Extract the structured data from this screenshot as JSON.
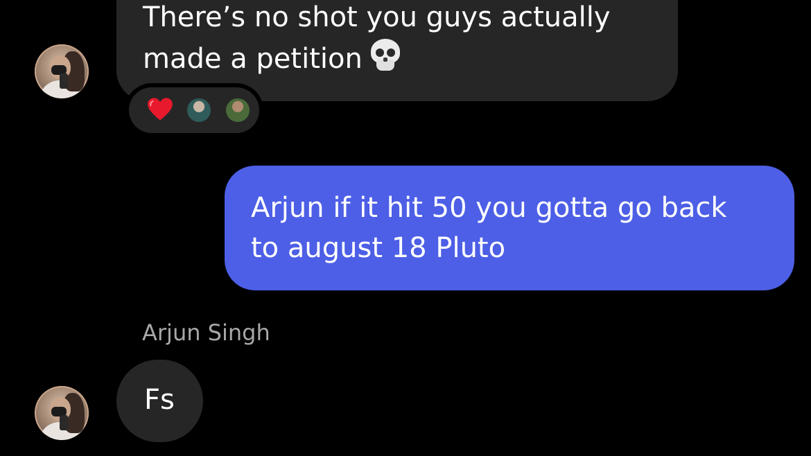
{
  "messages": [
    {
      "direction": "incoming",
      "lines": [
        "There’s no shot you guys actually",
        "made a petition"
      ],
      "emoji": "skull-icon",
      "reactions": {
        "emoji": "heart-icon",
        "reactors": [
          "reactor-avatar-1",
          "reactor-avatar-2"
        ]
      }
    },
    {
      "direction": "outgoing",
      "lines": [
        "Arjun if it hit 50 you gotta go back",
        "to august 18 Pluto"
      ]
    },
    {
      "direction": "incoming",
      "sender": "Arjun Singh",
      "lines": [
        "Fs"
      ]
    }
  ],
  "colors": {
    "background": "#000000",
    "incoming_bubble": "#262626",
    "outgoing_bubble": "#4d5fe6",
    "sender_name": "#a8a8a8",
    "heart": "#e8192c"
  }
}
